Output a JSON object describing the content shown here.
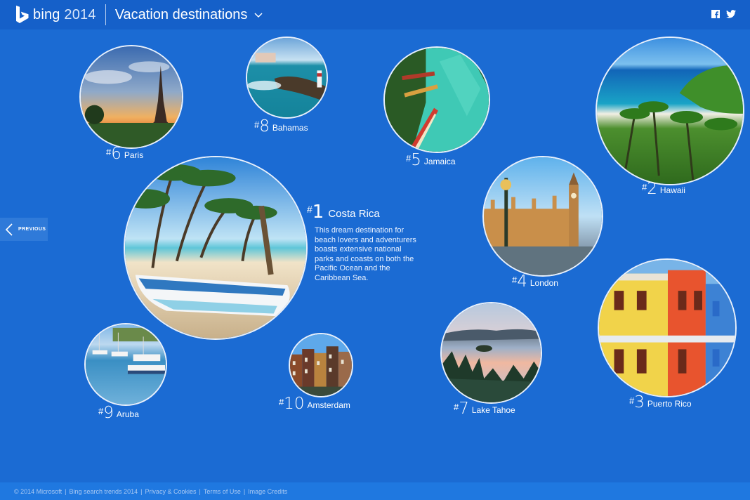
{
  "header": {
    "brand": "bing",
    "year": "2014",
    "title": "Vacation destinations"
  },
  "nav": {
    "previous_label": "PREVIOUS"
  },
  "featured": {
    "rank": "1",
    "name": "Costa Rica",
    "description": "This dream destination for beach lovers and adventurers boasts extensive national parks and coasts on both the Pacific Ocean and the Caribbean Sea."
  },
  "destinations": [
    {
      "rank": "6",
      "name": "Paris"
    },
    {
      "rank": "8",
      "name": "Bahamas"
    },
    {
      "rank": "5",
      "name": "Jamaica"
    },
    {
      "rank": "2",
      "name": "Hawaii"
    },
    {
      "rank": "4",
      "name": "London"
    },
    {
      "rank": "3",
      "name": "Puerto Rico"
    },
    {
      "rank": "9",
      "name": "Aruba"
    },
    {
      "rank": "10",
      "name": "Amsterdam"
    },
    {
      "rank": "7",
      "name": "Lake Tahoe"
    }
  ],
  "footer": {
    "copyright": "© 2014 Microsoft",
    "trends": "Bing search trends 2014",
    "privacy": "Privacy & Cookies",
    "terms": "Terms of Use",
    "credits": "Image Credits",
    "separator": "|"
  },
  "icons": {
    "facebook": "facebook-icon",
    "twitter": "twitter-icon",
    "chevron": "chevron-down-icon",
    "previous": "chevron-left-icon"
  },
  "colors": {
    "background": "#1b6bd3",
    "header": "#1560c9",
    "footer": "#1f78e0"
  }
}
